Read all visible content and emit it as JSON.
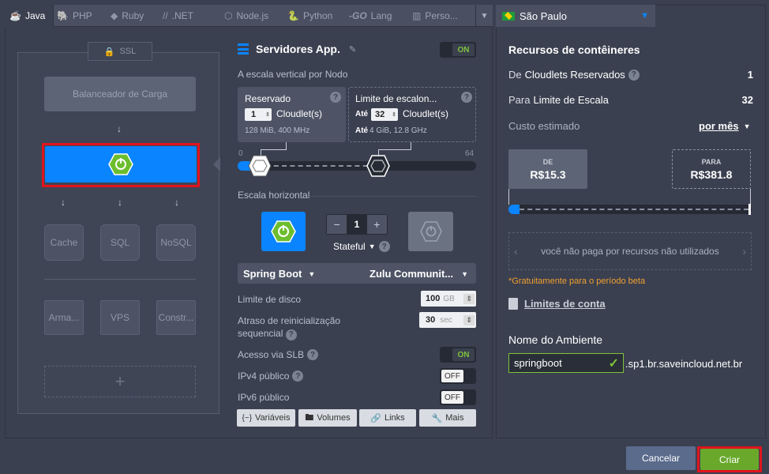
{
  "tabs": [
    {
      "label": "Java",
      "icon": "java-icon"
    },
    {
      "label": "PHP",
      "icon": "php-icon"
    },
    {
      "label": "Ruby",
      "icon": "ruby-icon"
    },
    {
      "label": ".NET",
      "icon": "dotnet-icon"
    },
    {
      "label": "Node.js",
      "icon": "nodejs-icon"
    },
    {
      "label": "Python",
      "icon": "python-icon"
    },
    {
      "label": "Lang",
      "icon": "go-icon",
      "prefix": "-GO"
    },
    {
      "label": "Perso...",
      "icon": "custom-icon"
    }
  ],
  "topology": {
    "ssl": "SSL",
    "load_balancer": "Balanceador de Carga",
    "cache": "Cache",
    "sql": "SQL",
    "nosql": "NoSQL",
    "storage": "Arma...",
    "vps": "VPS",
    "build": "Constr...",
    "add": "+"
  },
  "server": {
    "title": "Servidores App.",
    "toggle": "ON",
    "vertical_label": "A escala vertical por Nodo",
    "reserved": {
      "title": "Reservado",
      "value": "1",
      "unit": "Cloudlet(s)",
      "desc": "128 MiB, 400 MHz"
    },
    "limit": {
      "title": "Limite de escalon...",
      "prefix": "Até",
      "value": "32",
      "unit": "Cloudlet(s)",
      "desc_prefix": "Até",
      "desc": "4 GiB, 12.8 GHz"
    },
    "slider": {
      "min": "0",
      "max": "64",
      "reserved_value": 1,
      "limit_value": 32
    },
    "horizontal_label": "Escala horizontal",
    "node_count": "1",
    "minus": "−",
    "plus": "+",
    "stateful": "Stateful",
    "stack": "Spring Boot",
    "version": "Zulu Communit...",
    "disk_label": "Limite de disco",
    "disk_value": "100",
    "disk_unit": "GB",
    "restart_label": "Atraso de reinicialização sequencial",
    "restart_value": "30",
    "restart_unit": "sec",
    "slb_label": "Acesso via SLB",
    "slb_toggle": "ON",
    "ipv4_label": "IPv4 público",
    "ipv4_toggle": "OFF",
    "ipv6_label": "IPv6 público",
    "ipv6_toggle": "OFF",
    "buttons": {
      "vars": "Variáveis",
      "vars_icon": "{~}",
      "volumes": "Volumes",
      "links": "Links",
      "more": "Mais"
    }
  },
  "right": {
    "region": "São Paulo",
    "resources_title": "Recursos de contêineres",
    "reserved_label_a": "De",
    "reserved_label_b": "Cloudlets Reservados",
    "reserved_value": "1",
    "scale_label_a": "Para",
    "scale_label_b": "Limite de Escala",
    "scale_value": "32",
    "cost_label": "Custo estimado",
    "cost_period": "por mês",
    "from_label": "DE",
    "from_value": "R$15.3",
    "to_label": "PARA",
    "to_value": "R$381.8",
    "unused_note": "você não paga por recursos não utilizados",
    "free_note": "*Gratuitamente para o período beta",
    "account_limits": "Limites de conta",
    "env_label": "Nome do Ambiente",
    "env_value": "springboot",
    "domain": ".sp1.br.saveincloud.net.br"
  },
  "footer": {
    "cancel": "Cancelar",
    "create": "Criar"
  },
  "colors": {
    "accent_blue": "#0b84ff",
    "green": "#7ec23c",
    "highlight": "#e0141e",
    "bg": "#3b4050"
  }
}
